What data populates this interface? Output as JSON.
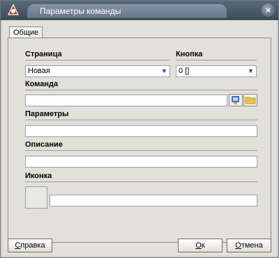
{
  "window": {
    "title": "Параметры команды"
  },
  "tabs": [
    {
      "label": "Общие"
    }
  ],
  "page": {
    "label": "Страница",
    "value": "Новая"
  },
  "button": {
    "label": "Кнопка",
    "value": "0 []"
  },
  "command": {
    "label": "Команда",
    "value": ""
  },
  "params": {
    "label": "Параметры",
    "value": ""
  },
  "description": {
    "label": "Описание",
    "value": ""
  },
  "icon": {
    "label": "Иконка",
    "value": ""
  },
  "footer": {
    "help_mnemonic": "С",
    "help_rest": "правка",
    "ok_mnemonic": "О",
    "ok_rest": "к",
    "cancel_mnemonic": "О",
    "cancel_rest": "тмена"
  }
}
